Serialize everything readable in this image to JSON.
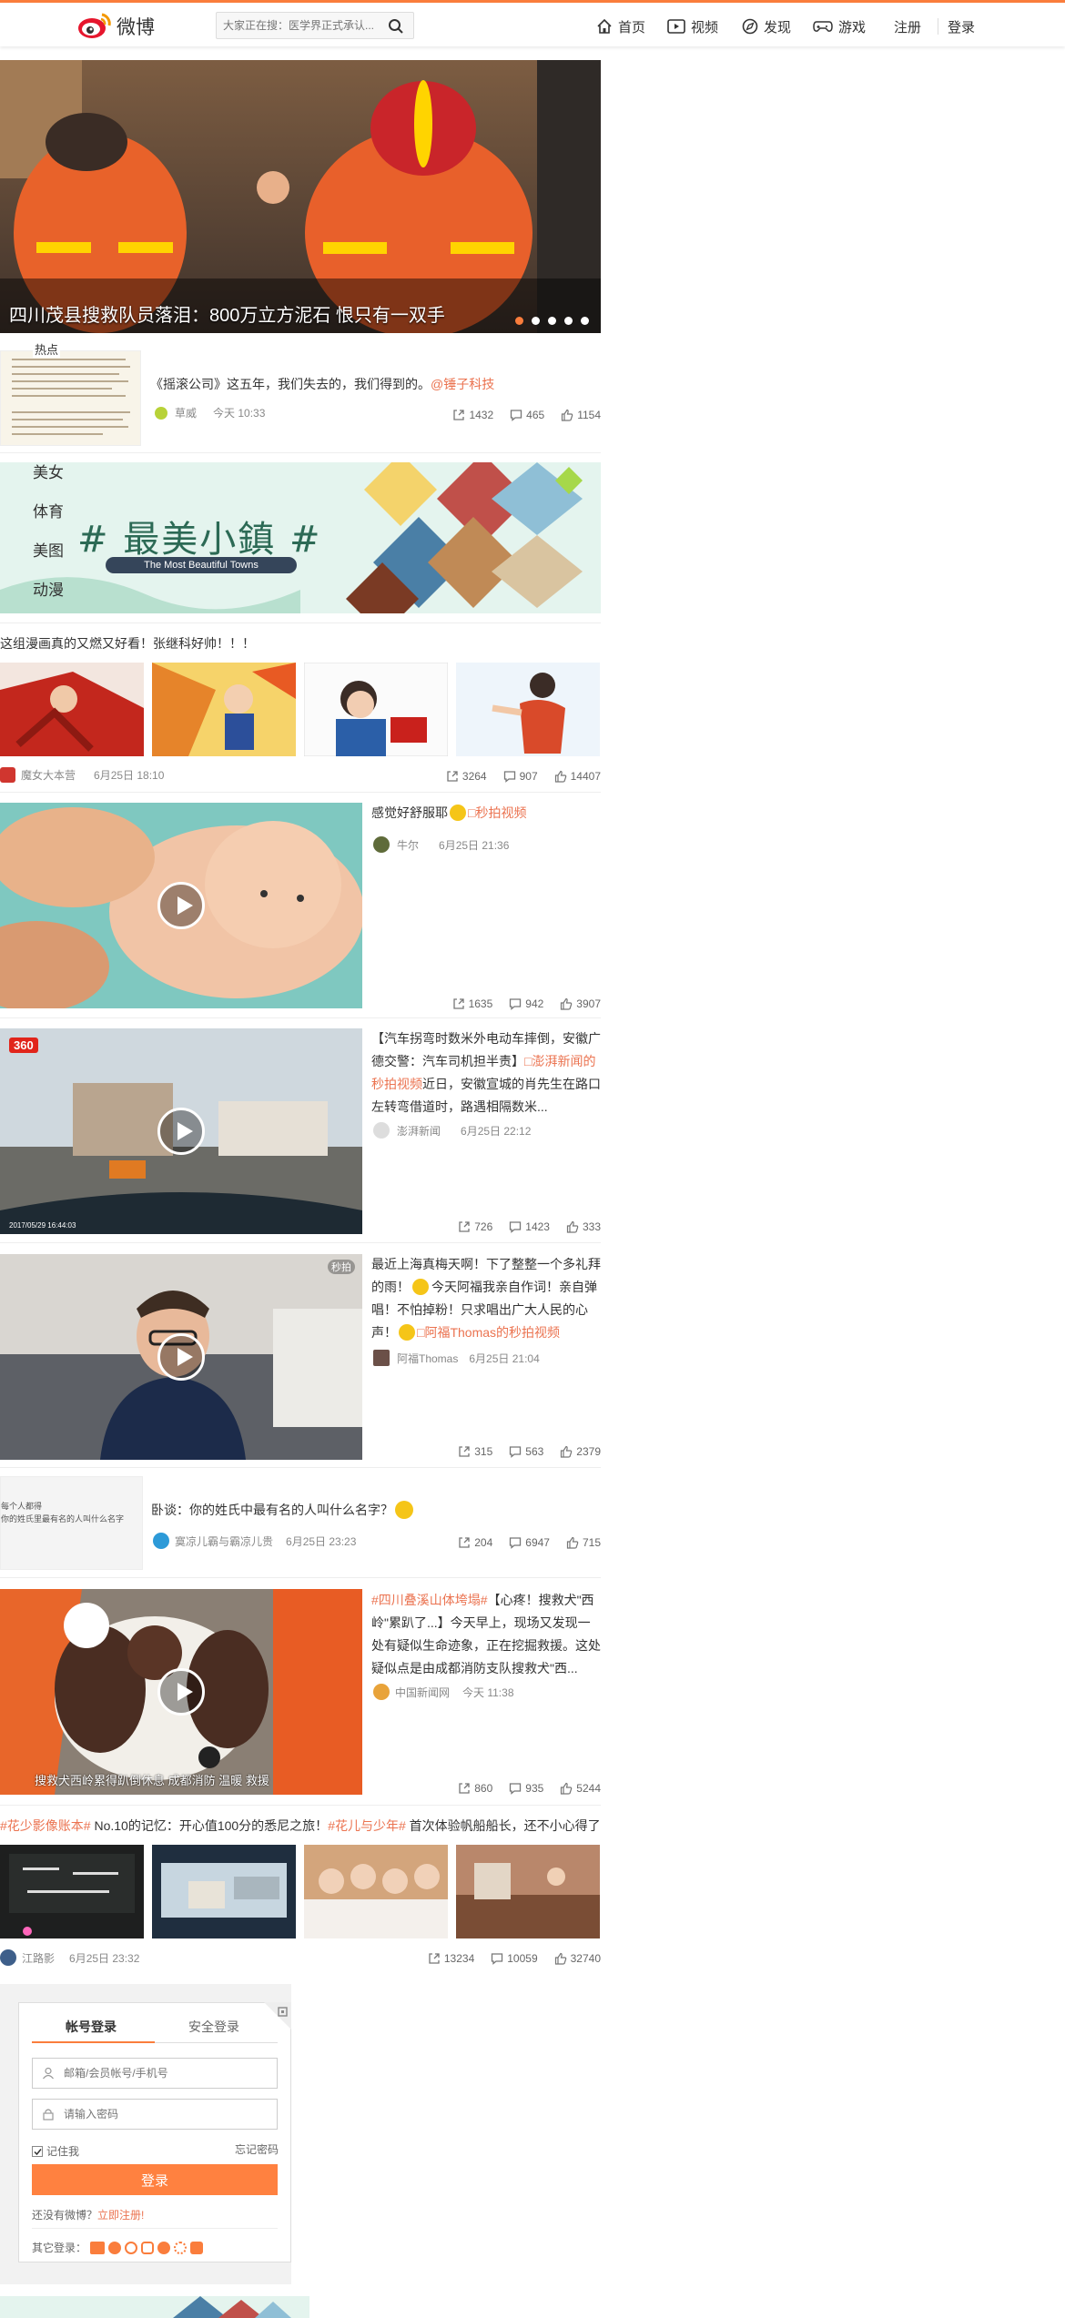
{
  "topbar": {
    "logo_text": "微博",
    "search_placeholder": "大家正在搜：医学界正式承认...",
    "nav": [
      {
        "label": "首页",
        "icon": "home-icon"
      },
      {
        "label": "视频",
        "icon": "video-icon"
      },
      {
        "label": "发现",
        "icon": "discover-icon"
      },
      {
        "label": "游戏",
        "icon": "game-icon"
      }
    ],
    "register": "注册",
    "login": "登录"
  },
  "banner": {
    "caption": "四川茂县搜救队员落泪：800万立方泥石 恨只有一双手",
    "dots": 5,
    "active_dot": 0
  },
  "hot_tag": "热点",
  "feed": {
    "post1": {
      "text_a": "《摇滚公司》这五年，我们失去的，我们得到的。",
      "text_b": "@锤子科技",
      "author": "草威",
      "time": "今天 10:33",
      "shares": "1432",
      "comments": "465",
      "likes": "1154"
    },
    "categories": [
      "美女",
      "体育",
      "美图",
      "动漫"
    ],
    "towns": {
      "title": "# 最美小鎮 #",
      "subtitle": "The Most Beautiful Towns"
    },
    "post2": {
      "text": "这组漫画真的又燃又好看！张继科好帅！！！",
      "author": "魔女大本营",
      "time": "6月25日 18:10",
      "shares": "3264",
      "comments": "907",
      "likes": "14407"
    },
    "video1": {
      "text_a": "感觉好舒服耶",
      "text_b": "□秒拍视频",
      "author": "牛尔",
      "time": "6月25日 21:36",
      "shares": "1635",
      "comments": "942",
      "likes": "3907"
    },
    "video2": {
      "text_a": "【汽车拐弯时数米外电动车摔倒，安徽广德交警：汽车司机担半责】",
      "text_b": "□澎湃新闻的秒拍视频",
      "text_c": "近日，安徽宣城的肖先生在路口左转弯借道时，路遇相隔数米...",
      "author": "澎湃新闻",
      "time": "6月25日 22:12",
      "shares": "726",
      "comments": "1423",
      "likes": "333",
      "badge": "360",
      "timestamp": "2017/05/29 16:44:03"
    },
    "video3": {
      "text_a": "最近上海真梅天啊！下了整整一个多礼拜的雨！",
      "text_b": "今天阿福我亲自作词！亲自弹唱！不怕掉粉！只求唱出广大人民的心声！",
      "text_c": "□阿福Thomas的秒拍视频",
      "author": "阿福Thomas",
      "time": "6月25日 21:04",
      "shares": "315",
      "comments": "563",
      "likes": "2379",
      "badge": "秒拍"
    },
    "post3": {
      "text": "卧谈：你的姓氏中最有名的人叫什么名字？",
      "thumb_text": "每个人都得\n你的姓氏里最有名的人叫什么名字",
      "author": "寞凉儿霸与霸凉儿贵",
      "time": "6月25日 23:23",
      "shares": "204",
      "comments": "6947",
      "likes": "715"
    },
    "video4": {
      "text_a": "#四川叠溪山体垮塌#",
      "text_b": "【心疼！搜救犬\"西岭\"累趴了...】今天早上，现场又发现一处有疑似生命迹象，正在挖掘救援。这处疑似点是由成都消防支队搜救犬\"西...",
      "author": "中国新闻网",
      "time": "今天 11:38",
      "shares": "860",
      "comments": "935",
      "likes": "5244",
      "subtitle": "搜救犬西岭累得趴倒休息 成都消防 温暖 救援"
    },
    "post4": {
      "tag_a": "#花少影像账本#",
      "text_a": " No.10的记忆：开心值100分的悉尼之旅！",
      "tag_b": "#花儿与少年#",
      "text_b": " 首次体验帆船船长，还不小心得了",
      "author": "江路影",
      "time": "6月25日 23:32",
      "shares": "13234",
      "comments": "10059",
      "likes": "32740"
    }
  },
  "login": {
    "tab_account": "帐号登录",
    "tab_secure": "安全登录",
    "user_placeholder": "邮箱/会员帐号/手机号",
    "pass_placeholder": "请输入密码",
    "remember": "记住我",
    "forgot": "忘记密码",
    "submit": "登录",
    "no_account": "还没有微博？",
    "register_link": "立即注册!",
    "other_login": "其它登录："
  }
}
